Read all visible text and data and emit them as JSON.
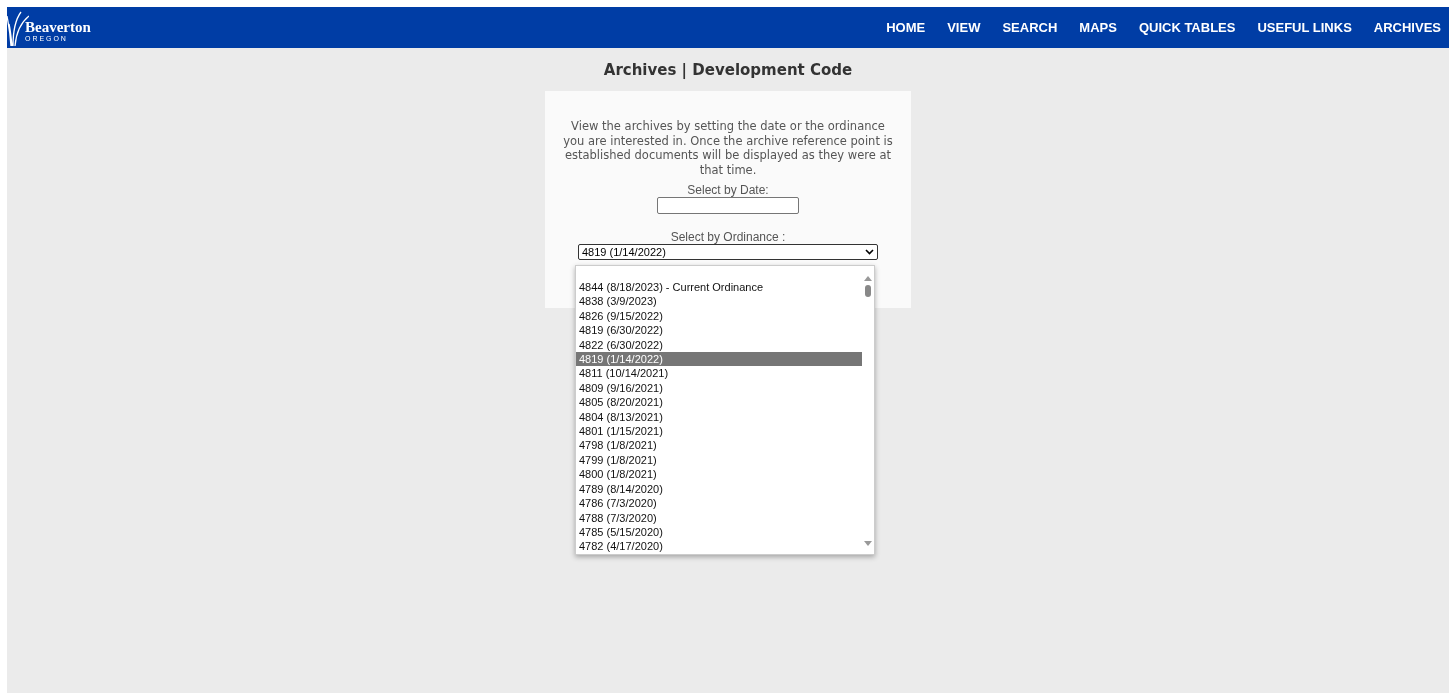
{
  "logo": {
    "name": "Beaverton",
    "tagline": "O R E G O N"
  },
  "nav": [
    {
      "label": "HOME"
    },
    {
      "label": "VIEW"
    },
    {
      "label": "SEARCH"
    },
    {
      "label": "MAPS"
    },
    {
      "label": "QUICK TABLES"
    },
    {
      "label": "USEFUL LINKS"
    },
    {
      "label": "ARCHIVES"
    }
  ],
  "title": "Archives | Development Code",
  "intro": "View the archives by setting the date or the ordinance you are interested in. Once the archive reference point is established documents will be displayed as they were at that time.",
  "date_field": {
    "label": "Select by Date:"
  },
  "ordinance_select": {
    "label": "Select by Ordinance :",
    "value": "4819 (1/14/2022)",
    "expanded": true,
    "options": [
      {
        "label": "4844 (8/18/2023) - Current Ordinance",
        "selected": false
      },
      {
        "label": "4838 (3/9/2023)",
        "selected": false
      },
      {
        "label": "4826 (9/15/2022)",
        "selected": false
      },
      {
        "label": "4819 (6/30/2022)",
        "selected": false
      },
      {
        "label": "4822 (6/30/2022)",
        "selected": false
      },
      {
        "label": "4819 (1/14/2022)",
        "selected": true
      },
      {
        "label": "4811 (10/14/2021)",
        "selected": false
      },
      {
        "label": "4809 (9/16/2021)",
        "selected": false
      },
      {
        "label": "4805 (8/20/2021)",
        "selected": false
      },
      {
        "label": "4804 (8/13/2021)",
        "selected": false
      },
      {
        "label": "4801 (1/15/2021)",
        "selected": false
      },
      {
        "label": "4798 (1/8/2021)",
        "selected": false
      },
      {
        "label": "4799 (1/8/2021)",
        "selected": false
      },
      {
        "label": "4800 (1/8/2021)",
        "selected": false
      },
      {
        "label": "4789 (8/14/2020)",
        "selected": false
      },
      {
        "label": "4786 (7/3/2020)",
        "selected": false
      },
      {
        "label": "4788 (7/3/2020)",
        "selected": false
      },
      {
        "label": "4785 (5/15/2020)",
        "selected": false
      },
      {
        "label": "4782 (4/17/2020)",
        "selected": false
      }
    ]
  }
}
